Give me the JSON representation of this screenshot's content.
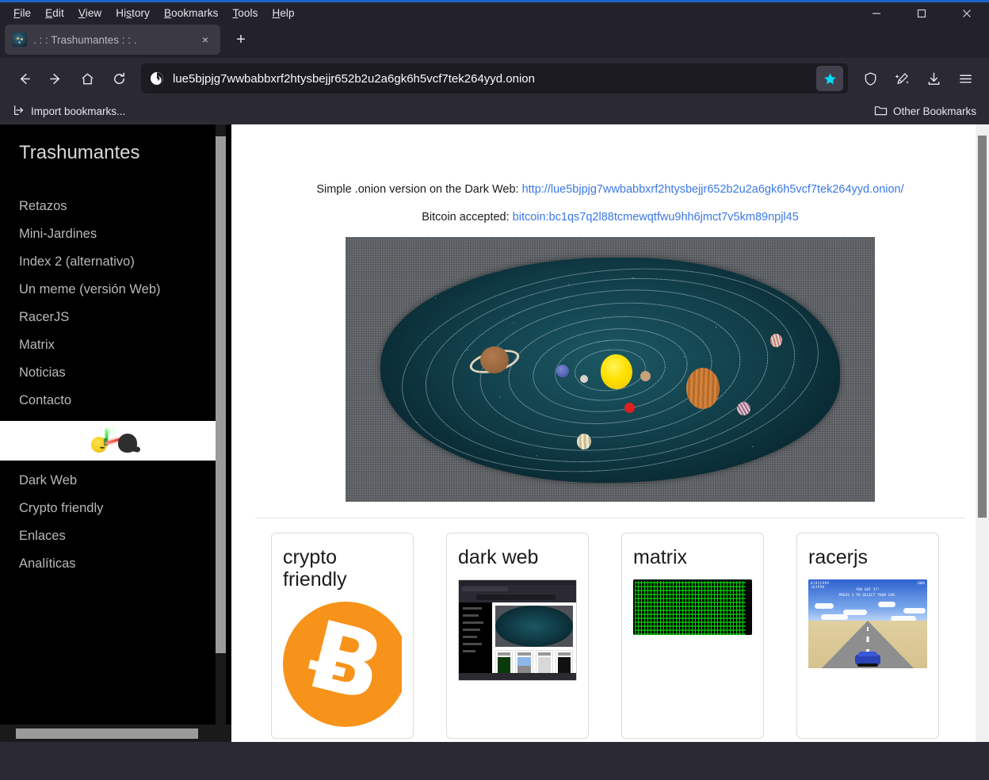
{
  "browser": {
    "menus": [
      "File",
      "Edit",
      "View",
      "History",
      "Bookmarks",
      "Tools",
      "Help"
    ],
    "window_controls": {
      "minimize": "minimize-icon",
      "maximize": "maximize-icon",
      "close": "close-icon"
    },
    "tab": {
      "title": ". : : Trashumantes : : .",
      "favicon": "trashumantes-favicon",
      "close": "×"
    },
    "new_tab_label": "+",
    "nav": {
      "back": "back-arrow-icon",
      "forward": "forward-arrow-icon",
      "home": "home-icon",
      "reload": "reload-icon",
      "url": "lue5bjpjg7wwbabbxrf2htysbejjr652b2u2a6gk6h5vcf7tek264yyd.onion",
      "site_icon": "onion-icon",
      "bookmark_star": "star-icon",
      "shield": "shield-icon",
      "cleanup": "broom-sparkle-icon",
      "downloads": "download-icon",
      "menu": "hamburger-menu-icon"
    },
    "bookmarks_bar": {
      "import_label": "Import bookmarks...",
      "import_icon": "import-icon",
      "other_label": "Other Bookmarks",
      "other_icon": "folder-icon"
    }
  },
  "page": {
    "sidebar": {
      "title": "Trashumantes",
      "items_top": [
        {
          "label": "Retazos"
        },
        {
          "label": "Mini-Jardines"
        },
        {
          "label": "Index 2 (alternativo)"
        },
        {
          "label": "Un meme (versión Web)"
        },
        {
          "label": "RacerJS"
        },
        {
          "label": "Matrix"
        },
        {
          "label": "Noticias"
        },
        {
          "label": "Contacto"
        }
      ],
      "meme_row": {
        "name": "meme-pixel-art",
        "alt": "pixel art lightsaber duel"
      },
      "items_bottom": [
        {
          "label": "Dark Web"
        },
        {
          "label": "Crypto friendly"
        },
        {
          "label": "Enlaces"
        },
        {
          "label": "Analíticas"
        }
      ]
    },
    "intro": {
      "line1_prefix": "Simple .onion version on the Dark Web: ",
      "line1_link": "http://lue5bjpjg7wwbabbxrf2htysbejjr652b2u2a6gk6h5vcf7tek264yyd.onion/",
      "line2_prefix": "Bitcoin accepted: ",
      "line2_link": "bitcoin:bc1qs7q2l88tcmewqtfwu9hh6jmct7v5km89npjl45"
    },
    "hero": {
      "name": "solar-system-mat-photo",
      "alt": "handmade solar system fabric mat on carpet"
    },
    "cards": [
      {
        "title": "crypto friendly",
        "thumb": "bitcoin-logo",
        "symbol": "Ƀ"
      },
      {
        "title": "dark web",
        "thumb": "darkweb-screenshot"
      },
      {
        "title": "matrix",
        "thumb": "matrix-rain-screenshot"
      },
      {
        "title": "racerjs",
        "thumb": "racerjs-game-screenshot",
        "hud": {
          "score": "01911999",
          "speed": "163PPH",
          "zoom": "100X",
          "line1": "YOU GOT IT!",
          "line2": "PRESS 1 TO SELECT YOUR CAR."
        }
      }
    ]
  },
  "colors": {
    "chrome_bg": "#2b2a33",
    "chrome_dark": "#23222b",
    "urlbar_bg": "#1c1b22",
    "accent_star": "#00d9f5",
    "link": "#3b78e7",
    "sidebar_bg": "#000000",
    "bitcoin_orange": "#f7931a",
    "matrix_green": "#00cc00"
  }
}
